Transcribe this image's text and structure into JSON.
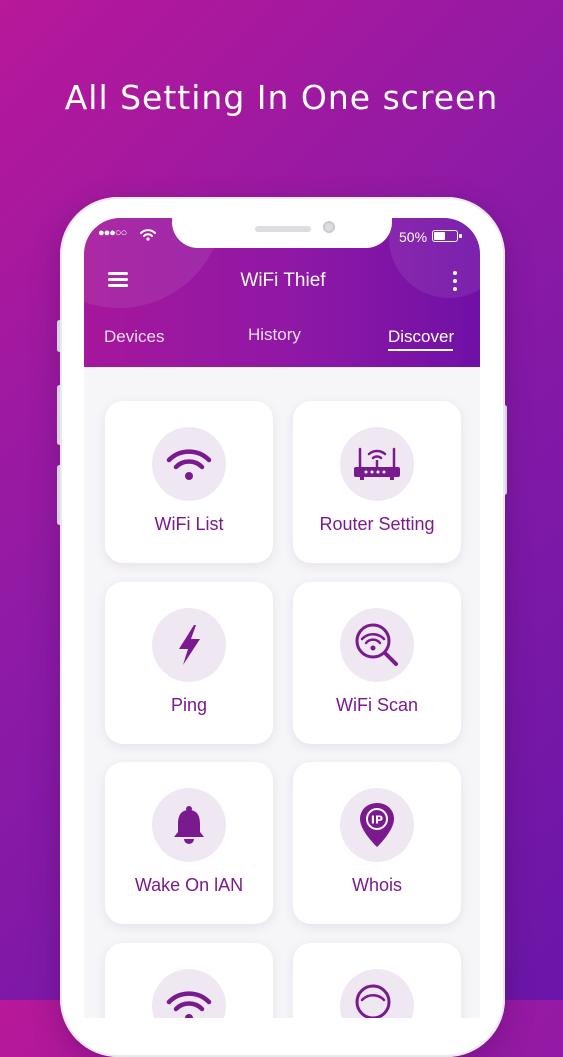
{
  "headline": "All Setting In One screen",
  "status_bar": {
    "signal": "●●●○○",
    "battery_text": "50%",
    "battery_level": 0.5
  },
  "app_bar": {
    "title": "WiFi Thief"
  },
  "tabs": [
    {
      "label": "Devices",
      "active": false
    },
    {
      "label": "History",
      "active": false
    },
    {
      "label": "Discover",
      "active": true
    }
  ],
  "tiles": [
    {
      "label": "WiFi List",
      "icon": "wifi-icon"
    },
    {
      "label": "Router Setting",
      "icon": "router-icon"
    },
    {
      "label": "Ping",
      "icon": "lightning-icon"
    },
    {
      "label": "WiFi Scan",
      "icon": "wifi-scan-icon"
    },
    {
      "label": "Wake On lAN",
      "icon": "bell-icon"
    },
    {
      "label": "Whois",
      "icon": "ip-location-icon"
    },
    {
      "label": "",
      "icon": "wifi-icon"
    },
    {
      "label": "",
      "icon": "wifi-scan-icon"
    }
  ],
  "colors": {
    "accent": "#8e18a6",
    "icon": "#7b1a8e",
    "icon_bg": "#efe8f2",
    "background_start": "#b8189a",
    "background_end": "#6a16a8"
  }
}
